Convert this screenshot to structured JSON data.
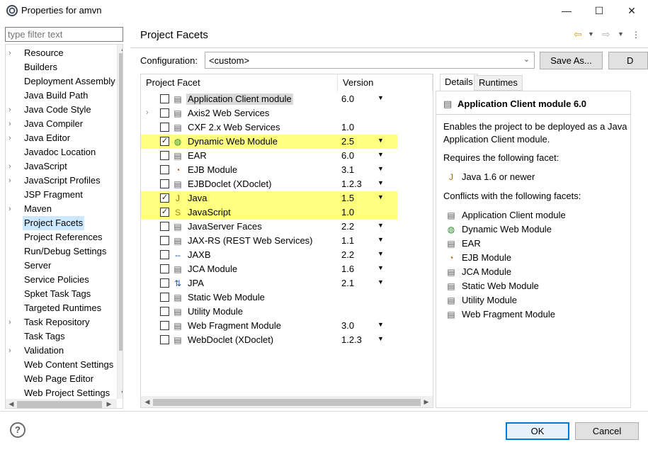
{
  "window": {
    "title": "Properties for amvn",
    "minimize": "—",
    "maximize": "☐",
    "close": "✕"
  },
  "filter": {
    "placeholder": "type filter text"
  },
  "nav": {
    "items": [
      {
        "label": "Resource",
        "expandable": true
      },
      {
        "label": "Builders",
        "expandable": false
      },
      {
        "label": "Deployment Assembly",
        "expandable": false
      },
      {
        "label": "Java Build Path",
        "expandable": false
      },
      {
        "label": "Java Code Style",
        "expandable": true
      },
      {
        "label": "Java Compiler",
        "expandable": true
      },
      {
        "label": "Java Editor",
        "expandable": true
      },
      {
        "label": "Javadoc Location",
        "expandable": false
      },
      {
        "label": "JavaScript",
        "expandable": true
      },
      {
        "label": "JavaScript Profiles",
        "expandable": true
      },
      {
        "label": "JSP Fragment",
        "expandable": false
      },
      {
        "label": "Maven",
        "expandable": true
      },
      {
        "label": "Project Facets",
        "expandable": false,
        "selected": true
      },
      {
        "label": "Project References",
        "expandable": false
      },
      {
        "label": "Run/Debug Settings",
        "expandable": false
      },
      {
        "label": "Server",
        "expandable": false
      },
      {
        "label": "Service Policies",
        "expandable": false
      },
      {
        "label": "Spket Task Tags",
        "expandable": false
      },
      {
        "label": "Targeted Runtimes",
        "expandable": false
      },
      {
        "label": "Task Repository",
        "expandable": true
      },
      {
        "label": "Task Tags",
        "expandable": false
      },
      {
        "label": "Validation",
        "expandable": true
      },
      {
        "label": "Web Content Settings",
        "expandable": false
      },
      {
        "label": "Web Page Editor",
        "expandable": false
      },
      {
        "label": "Web Project Settings",
        "expandable": false
      }
    ]
  },
  "page": {
    "title": "Project Facets",
    "back_icon": "⇦",
    "forward_icon": "⇨"
  },
  "configuration": {
    "label": "Configuration:",
    "value": "<custom>",
    "save_as": "Save As...",
    "delete": "D"
  },
  "facets": {
    "col_facet": "Project Facet",
    "col_version": "Version",
    "rows": [
      {
        "name": "Application Client module",
        "version": "6.0",
        "checked": false,
        "icon": "doc",
        "dropdown": true,
        "selected": true,
        "highlight": false,
        "expander": false
      },
      {
        "name": "Axis2 Web Services",
        "version": "",
        "checked": false,
        "icon": "doc",
        "dropdown": false,
        "highlight": false,
        "expander": true
      },
      {
        "name": "CXF 2.x Web Services",
        "version": "1.0",
        "checked": false,
        "icon": "doc",
        "dropdown": false,
        "highlight": false,
        "expander": false
      },
      {
        "name": "Dynamic Web Module",
        "version": "2.5",
        "checked": true,
        "icon": "web",
        "dropdown": true,
        "highlight": true,
        "expander": false
      },
      {
        "name": "EAR",
        "version": "6.0",
        "checked": false,
        "icon": "doc",
        "dropdown": true,
        "highlight": false,
        "expander": false
      },
      {
        "name": "EJB Module",
        "version": "3.1",
        "checked": false,
        "icon": "ejb",
        "dropdown": true,
        "highlight": false,
        "expander": false
      },
      {
        "name": "EJBDoclet (XDoclet)",
        "version": "1.2.3",
        "checked": false,
        "icon": "doc",
        "dropdown": true,
        "highlight": false,
        "expander": false
      },
      {
        "name": "Java",
        "version": "1.5",
        "checked": true,
        "icon": "java",
        "dropdown": true,
        "highlight": true,
        "expander": false
      },
      {
        "name": "JavaScript",
        "version": "1.0",
        "checked": true,
        "icon": "js",
        "dropdown": false,
        "highlight": true,
        "expander": false
      },
      {
        "name": "JavaServer Faces",
        "version": "2.2",
        "checked": false,
        "icon": "doc",
        "dropdown": true,
        "highlight": false,
        "expander": false
      },
      {
        "name": "JAX-RS (REST Web Services)",
        "version": "1.1",
        "checked": false,
        "icon": "doc",
        "dropdown": true,
        "highlight": false,
        "expander": false
      },
      {
        "name": "JAXB",
        "version": "2.2",
        "checked": false,
        "icon": "jaxb",
        "dropdown": true,
        "highlight": false,
        "expander": false
      },
      {
        "name": "JCA Module",
        "version": "1.6",
        "checked": false,
        "icon": "doc",
        "dropdown": true,
        "highlight": false,
        "expander": false
      },
      {
        "name": "JPA",
        "version": "2.1",
        "checked": false,
        "icon": "jpa",
        "dropdown": true,
        "highlight": false,
        "expander": false
      },
      {
        "name": "Static Web Module",
        "version": "",
        "checked": false,
        "icon": "doc",
        "dropdown": false,
        "highlight": false,
        "expander": false
      },
      {
        "name": "Utility Module",
        "version": "",
        "checked": false,
        "icon": "doc",
        "dropdown": false,
        "highlight": false,
        "expander": false
      },
      {
        "name": "Web Fragment Module",
        "version": "3.0",
        "checked": false,
        "icon": "doc",
        "dropdown": true,
        "highlight": false,
        "expander": false
      },
      {
        "name": "WebDoclet (XDoclet)",
        "version": "1.2.3",
        "checked": false,
        "icon": "doc",
        "dropdown": true,
        "highlight": false,
        "expander": false
      }
    ]
  },
  "details": {
    "tab_details": "Details",
    "tab_runtimes": "Runtimes",
    "heading": "Application Client module 6.0",
    "description_line1": "Enables the project to be deployed as a Java",
    "description_line2": "Application Client module.",
    "requires_label": "Requires the following facet:",
    "requires": [
      {
        "name": "Java 1.6 or newer",
        "icon": "java"
      }
    ],
    "conflicts_label": "Conflicts with the following facets:",
    "conflicts": [
      {
        "name": "Application Client module",
        "icon": "doc"
      },
      {
        "name": "Dynamic Web Module",
        "icon": "web"
      },
      {
        "name": "EAR",
        "icon": "doc"
      },
      {
        "name": "EJB Module",
        "icon": "ejb"
      },
      {
        "name": "JCA Module",
        "icon": "doc"
      },
      {
        "name": "Static Web Module",
        "icon": "doc"
      },
      {
        "name": "Utility Module",
        "icon": "doc"
      },
      {
        "name": "Web Fragment Module",
        "icon": "doc"
      }
    ]
  },
  "footer": {
    "help": "?",
    "ok": "OK",
    "cancel": "Cancel"
  }
}
